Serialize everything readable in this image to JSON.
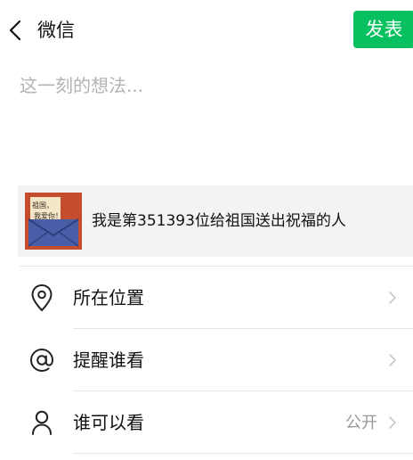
{
  "header": {
    "title": "微信",
    "publish_label": "发表"
  },
  "composer": {
    "placeholder": "这一刻的想法..."
  },
  "share_card": {
    "title": "我是第351393位给祖国送出祝福的人",
    "thumb_text": [
      "祖国，",
      "我爱你！"
    ]
  },
  "options": [
    {
      "label": "所在位置",
      "value": "",
      "icon": "location-pin-icon"
    },
    {
      "label": "提醒谁看",
      "value": "",
      "icon": "at-sign-icon"
    },
    {
      "label": "谁可以看",
      "value": "公开",
      "icon": "person-icon"
    }
  ],
  "colors": {
    "accent": "#07c160",
    "card_bg": "#f3f3f3",
    "placeholder": "#b3b3b3",
    "secondary_text": "#999999"
  }
}
